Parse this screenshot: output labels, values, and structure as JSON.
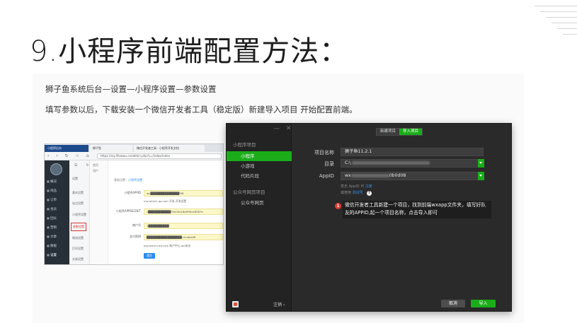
{
  "slide": {
    "title": "9.小程序前端配置方法：",
    "desc_line1": "狮子鱼系统后台—设置—小程序设置—参数设置",
    "desc_line2": "填写参数以后，下载安装一个微信开发者工具（稳定版）新建导入项目 开始配置前端。"
  },
  "browser": {
    "tabs": [
      "小程序后台",
      "狮子鱼",
      "微信开发者工具 · 小程序开发文档"
    ],
    "nav_icons": "‹ › ↻ ☆ ⌂",
    "url": "https://szy.lihaowu.cn/admin.php?s=/index/index",
    "sidebar_main": [
      "概况",
      "商品",
      "订单",
      "会员",
      "团长",
      "营销",
      "文章",
      "数据",
      "设置"
    ],
    "sidebar_sub": [
      "设置",
      "基本设置",
      "站点设置",
      "小程序设置",
      "参数设置",
      "物流设置",
      "打印设置",
      "交易设置"
    ],
    "sidebar_tertiary": [
      "首页",
      "用户"
    ],
    "breadcrumb_prefix": "基础设置：",
    "breadcrumb_active": "小程序设置",
    "fields": [
      {
        "label": "小程序APPID",
        "value": "wx██████████████f98"
      },
      {
        "label": "",
        "value": "mp.weixin.qq.com 开发-开发设置"
      },
      {
        "label": "小程序APPSECRET",
        "value": "c███████████f7bcf5e18ef9f5ce6367e"
      },
      {
        "label": "商户号",
        "value": "1██████████"
      },
      {
        "label": "支付密钥",
        "value": "█████████████████c2cdbcbf8"
      }
    ],
    "hint": "pay.weixin.qq.com 账户中心-api安全",
    "submit_label": "提交"
  },
  "devtool": {
    "window_controls": "— ✕",
    "section_mini": "小程序项目",
    "nav": [
      "小程序",
      "小游戏",
      "代码片段"
    ],
    "section_official": "公众号网页项目",
    "nav_official": [
      "公众号网页"
    ],
    "logout_label": "注销 ›",
    "seg_new": "新建项目",
    "seg_import": "导入项目",
    "fields": {
      "project_name_label": "项目名称",
      "project_name_value": "狮子鱼11.2.1",
      "dir_label": "目录",
      "dir_value": "C:\\",
      "appid_label": "AppID",
      "appid_prefix": "wx",
      "appid_suffix": "0b0d08"
    },
    "hint_line1": "若无 AppID 可 ",
    "hint_line1_link": "注册",
    "hint_line2": "或使用 ",
    "hint_line2_link": "测试号",
    "help_mark": "?",
    "annotation_badge": "1",
    "annotation": "微信开发者工具新建一个项目，找到前端wxapp文件夹，填写好队友的APPID,起一个项目名称，点击导入即可",
    "cancel_label": "取消",
    "import_label": "导入"
  }
}
